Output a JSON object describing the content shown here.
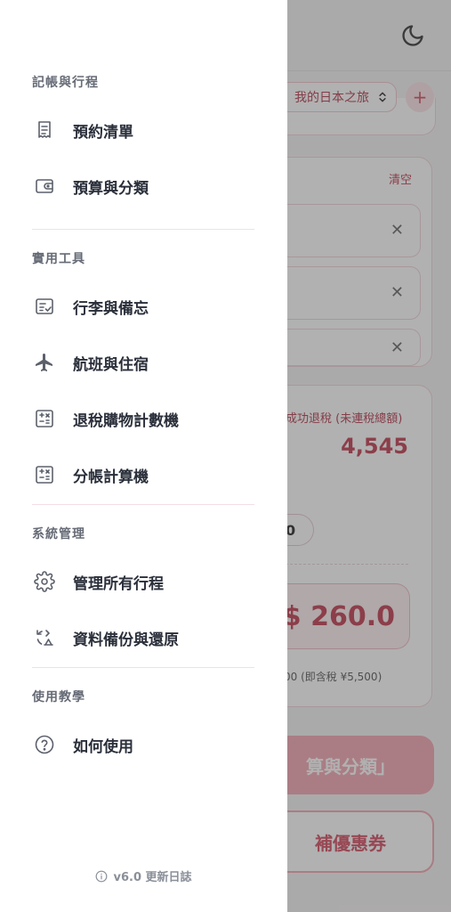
{
  "drawer": {
    "sections": [
      {
        "title": "記帳與行程",
        "items": [
          {
            "label": "預約清單",
            "icon": "receipt-icon"
          },
          {
            "label": "預算與分類",
            "icon": "wallet-icon"
          }
        ]
      },
      {
        "title": "實用工具",
        "items": [
          {
            "label": "行李與備忘",
            "icon": "checklist-icon"
          },
          {
            "label": "航班與住宿",
            "icon": "plane-icon"
          },
          {
            "label": "退稅購物計數機",
            "icon": "calculator-icon"
          },
          {
            "label": "分帳計算機",
            "icon": "calculator-icon"
          }
        ]
      },
      {
        "title": "系統管理",
        "items": [
          {
            "label": "管理所有行程",
            "icon": "gear-icon"
          },
          {
            "label": "資料備份與還原",
            "icon": "backup-restore-icon"
          }
        ]
      },
      {
        "title": "使用教學",
        "items": [
          {
            "label": "如何使用",
            "icon": "help-circle-icon"
          }
        ]
      }
    ],
    "version_label": "v6.0 更新日誌"
  },
  "background": {
    "trip_select_value": "我的日本之旅",
    "add_trip_symbol": "+",
    "clear_label": "清空",
    "remove_symbol": "✕",
    "refund_label": "成功退稅 (未連稅總額)",
    "refund_value": "4,545",
    "pill_input_value": "0",
    "total_value": "$ 260.0",
    "note_text": "00 (即含稅 ¥5,500)",
    "primary_button_label": "算與分類」",
    "secondary_button_label": "補優惠券"
  },
  "colors": {
    "accent": "#c0394e",
    "accent_light": "#f3a5b1",
    "drawer_bg": "#ffffff",
    "overlay": "rgba(70,70,70,0.42)"
  }
}
